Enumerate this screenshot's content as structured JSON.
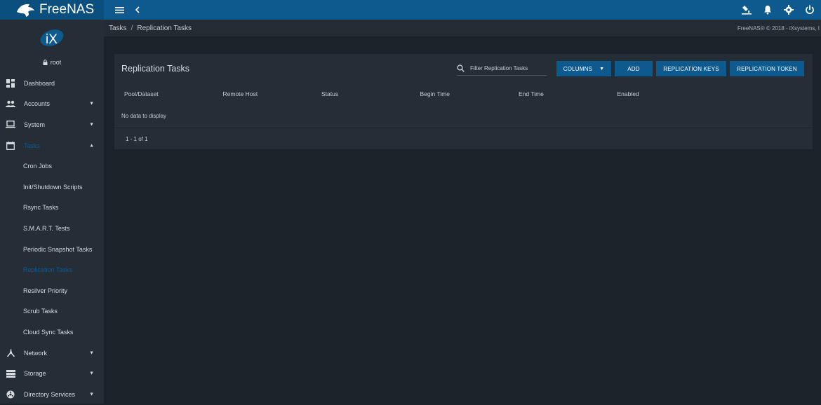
{
  "app": {
    "brand": "FreeNAS"
  },
  "topbar": {
    "menu_icon": "menu-icon",
    "back_icon": "chevron-left-icon",
    "right_icons": [
      "ship-icon",
      "bell-icon",
      "gear-icon",
      "power-icon"
    ]
  },
  "sidebar": {
    "logo": "iX",
    "user": "root",
    "items": [
      {
        "label": "Dashboard",
        "icon": "dashboard-icon",
        "caret": ""
      },
      {
        "label": "Accounts",
        "icon": "people-icon",
        "caret": "▼"
      },
      {
        "label": "System",
        "icon": "laptop-icon",
        "caret": "▼"
      },
      {
        "label": "Tasks",
        "icon": "calendar-icon",
        "caret": "▲"
      }
    ],
    "sub_items": [
      {
        "label": "Cron Jobs"
      },
      {
        "label": "Init/Shutdown Scripts"
      },
      {
        "label": "Rsync Tasks"
      },
      {
        "label": "S.M.A.R.T. Tests"
      },
      {
        "label": "Periodic Snapshot Tasks"
      },
      {
        "label": "Replication Tasks"
      },
      {
        "label": "Resilver Priority"
      },
      {
        "label": "Scrub Tasks"
      },
      {
        "label": "Cloud Sync Tasks"
      }
    ],
    "bottom_items": [
      {
        "label": "Network",
        "icon": "network-icon",
        "caret": "▼"
      },
      {
        "label": "Storage",
        "icon": "storage-icon",
        "caret": "▼"
      },
      {
        "label": "Directory Services",
        "icon": "directory-icon",
        "caret": "▼"
      }
    ]
  },
  "breadcrumb": {
    "parent": "Tasks",
    "separator": "/",
    "current": "Replication Tasks",
    "copyright": "FreeNAS® © 2018 - iXsystems, I"
  },
  "card": {
    "title": "Replication Tasks",
    "filter_placeholder": "Filter Replication Tasks",
    "buttons": {
      "columns": "COLUMNS",
      "add": "ADD",
      "keys": "REPLICATION KEYS",
      "token": "REPLICATION TOKEN"
    },
    "columns": [
      "Pool/Dataset",
      "Remote Host",
      "Status",
      "Begin Time",
      "End Time",
      "Enabled"
    ],
    "empty_text": "No data to display",
    "pagination": "1 - 1 of 1"
  },
  "colors": {
    "accent": "#0e5a8e",
    "sidebar": "#252d36",
    "background": "#1b222a"
  }
}
